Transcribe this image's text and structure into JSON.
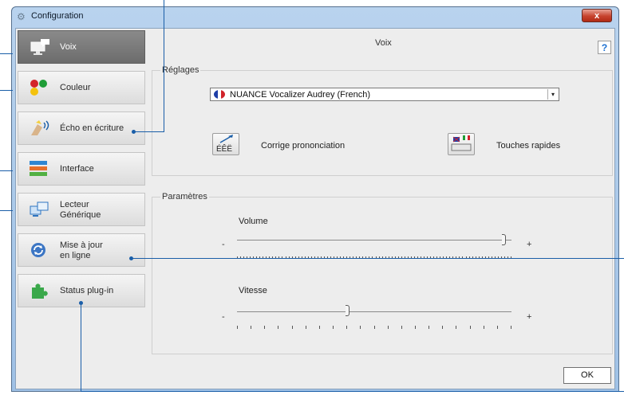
{
  "window": {
    "title": "Configuration",
    "close_glyph": "x"
  },
  "sidebar": {
    "items": [
      {
        "label": "Voix",
        "icon": "monitor-speech-icon",
        "active": true
      },
      {
        "label": "Couleur",
        "icon": "color-dots-icon"
      },
      {
        "label": "Écho en écriture",
        "icon": "typing-echo-icon"
      },
      {
        "label": "Interface",
        "icon": "interface-bars-icon"
      },
      {
        "label": "Lecteur",
        "label2": "Générique",
        "icon": "generic-reader-icon"
      },
      {
        "label": "Mise à jour",
        "label2": "en ligne",
        "icon": "update-refresh-icon"
      },
      {
        "label": "Status plug-in",
        "icon": "puzzle-plugin-icon"
      }
    ]
  },
  "main": {
    "title": "Voix",
    "help": "?",
    "settings": {
      "legend": "Réglages",
      "voice_selected": "NUANCE Vocalizer Audrey (French)",
      "pronunciation_label": "Corrige prononciation",
      "shortcuts_label": "Touches rapides"
    },
    "parameters": {
      "legend": "Paramètres",
      "volume": {
        "label": "Volume",
        "min": "-",
        "max": "+",
        "level": 0.98
      },
      "speed": {
        "label": "Vitesse",
        "min": "-",
        "max": "+",
        "level": 0.4
      }
    },
    "ok": "OK"
  },
  "colors": {
    "accent": "#1a5ea8",
    "active_nav": "#7a7a7a"
  }
}
